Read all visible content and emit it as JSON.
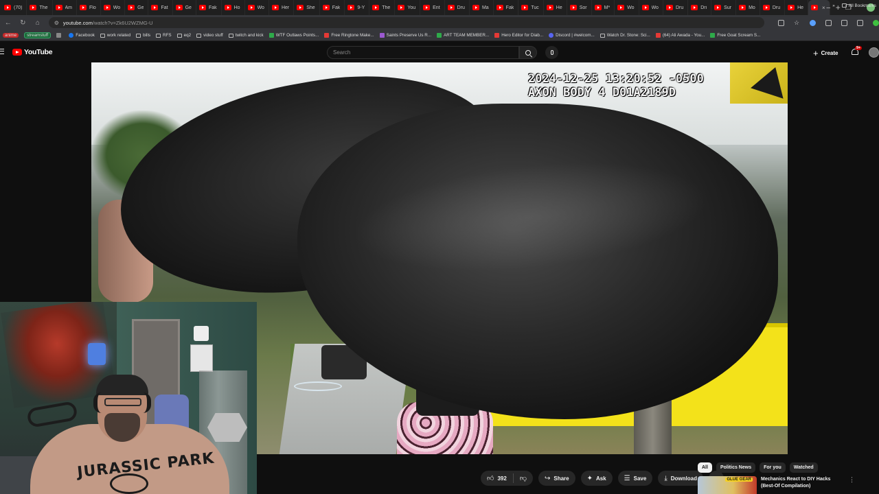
{
  "browser": {
    "tabs": [
      {
        "label": "(70)"
      },
      {
        "label": "The"
      },
      {
        "label": "Am"
      },
      {
        "label": "Flo"
      },
      {
        "label": "Wo"
      },
      {
        "label": "Ge"
      },
      {
        "label": "Fat"
      },
      {
        "label": "Ge"
      },
      {
        "label": "Fak"
      },
      {
        "label": "Ho"
      },
      {
        "label": "Wo"
      },
      {
        "label": "Her"
      },
      {
        "label": "She"
      },
      {
        "label": "Fak"
      },
      {
        "label": "9-Y"
      },
      {
        "label": "The"
      },
      {
        "label": "You"
      },
      {
        "label": "Ent"
      },
      {
        "label": "Dru"
      },
      {
        "label": "Ma"
      },
      {
        "label": "Fak"
      },
      {
        "label": "Tuc"
      },
      {
        "label": "He"
      },
      {
        "label": "Sor"
      },
      {
        "label": "M*"
      },
      {
        "label": "Wo"
      },
      {
        "label": "Wo"
      },
      {
        "label": "Dru"
      },
      {
        "label": "Dri"
      },
      {
        "label": "Sur"
      },
      {
        "label": "Mo"
      },
      {
        "label": "Dru"
      },
      {
        "label": "He"
      }
    ],
    "active_tab_close": "×",
    "new_tab": "+",
    "window_controls": {
      "minimize": "–",
      "restore": "❐",
      "close": "✕"
    },
    "url": {
      "host": "youtube.com",
      "path": "/watch?v=Zk6U2WZMG-U"
    },
    "bookmarks": [
      {
        "label": "anime",
        "style": "anime"
      },
      {
        "label": "streamstuff",
        "style": "pill"
      },
      {
        "label": "",
        "icon": "apps-grid-icon"
      },
      {
        "label": "Facebook",
        "icon": "fb"
      },
      {
        "label": "work related",
        "icon": "folder"
      },
      {
        "label": "bills",
        "icon": "folder"
      },
      {
        "label": "RFS",
        "icon": "folder"
      },
      {
        "label": "eq2",
        "icon": "folder"
      },
      {
        "label": "video stuff",
        "icon": "folder"
      },
      {
        "label": "twitch and kick",
        "icon": "folder"
      },
      {
        "label": "WTF Outlaws Points...",
        "icon": "green"
      },
      {
        "label": "Free Ringtone Make...",
        "icon": "red"
      },
      {
        "label": "Saints Preserve Us R...",
        "icon": "purple"
      },
      {
        "label": "ART TEAM MEMBER...",
        "icon": "green"
      },
      {
        "label": "Hero Editor for Diab...",
        "icon": "red"
      },
      {
        "label": "Discord | #welcom...",
        "icon": "discord"
      },
      {
        "label": "Watch Dr. Stone: Sci...",
        "icon": "folder"
      },
      {
        "label": "(64) Ali Awada - You...",
        "icon": "red"
      },
      {
        "label": "Free Goat Scream S...",
        "icon": "green"
      }
    ],
    "bookmarks_overflow": "»",
    "all_bookmarks": "All Bookmarks"
  },
  "youtube": {
    "logo_text": "YouTube",
    "search_placeholder": "Search",
    "create_label": "Create",
    "notification_badge": "9+",
    "video": {
      "timestamp_line1": "2024-12-25 13:20:52 -0500",
      "timestamp_line2": "AXON BODY 4 D01A2189D"
    },
    "webcam": {
      "shirt_text": "JURASSIC PARK"
    },
    "actions": {
      "like_count": "392",
      "share": "Share",
      "ask": "Ask",
      "save": "Save",
      "download": "Download",
      "more": "⋯"
    },
    "chips": [
      "All",
      "Politics News",
      "For you",
      "Watched"
    ],
    "suggestion": {
      "title": "Mechanics React to DIY Hacks (Best-Of Compilation)",
      "thumb_label": "GLUE GEAR"
    }
  },
  "colors": {
    "accent": "#ff0000",
    "bg": "#0f0f0f",
    "chip_active": "#f1f1f1",
    "wall_yellow": "#f3e21a"
  }
}
